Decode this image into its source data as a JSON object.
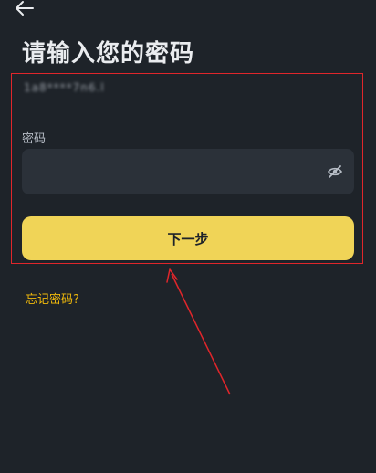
{
  "header": {
    "back_icon": "arrow-left-icon",
    "title": "请输入您的密码"
  },
  "account": {
    "masked_value": "1a8****7n6.l"
  },
  "password": {
    "label": "密码",
    "value": "",
    "placeholder": "",
    "toggle_icon": "eye-off-icon"
  },
  "actions": {
    "next_label": "下一步",
    "forgot_label": "忘记密码?"
  },
  "colors": {
    "background": "#1e2329",
    "field_background": "#2b3139",
    "primary_button": "#f0d457",
    "link": "#f0b90b",
    "annotation": "#e0262b"
  }
}
